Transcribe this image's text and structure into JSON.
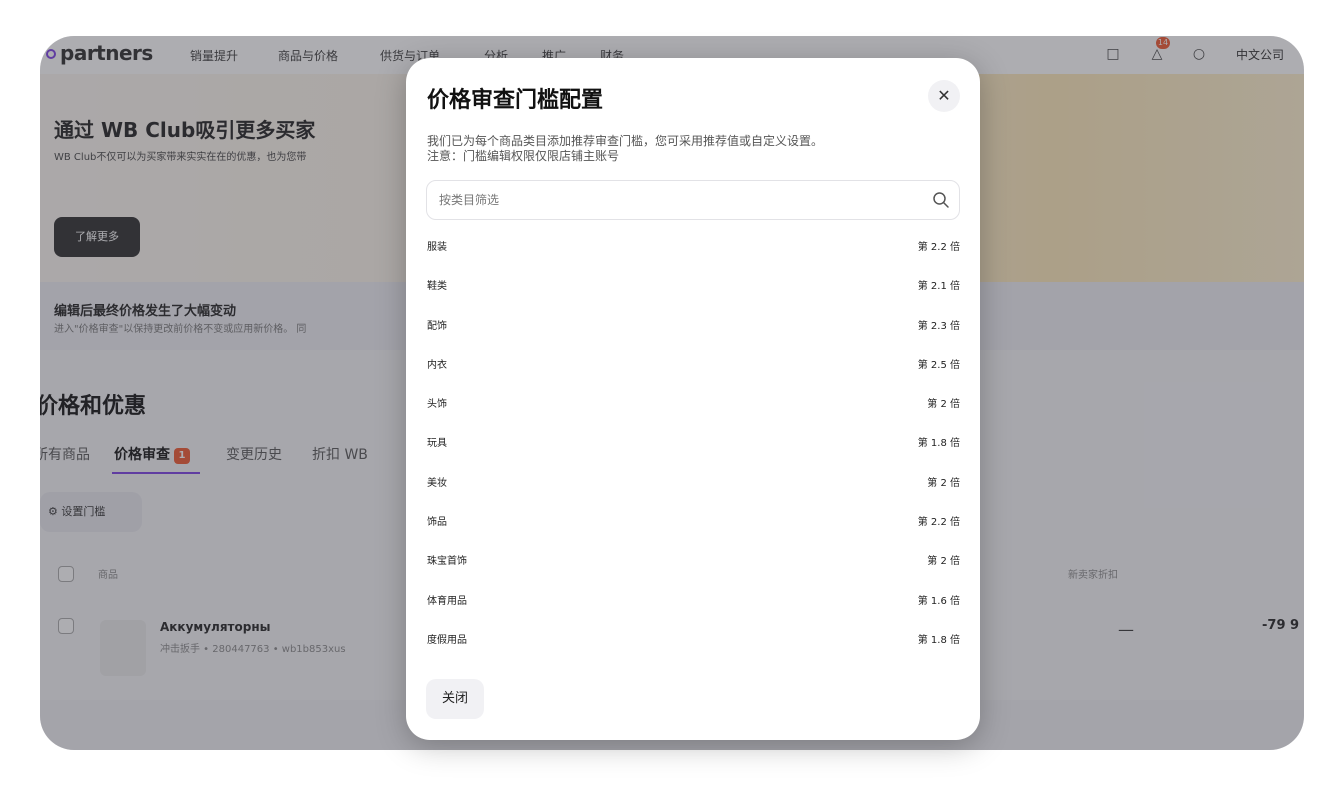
{
  "nav": {
    "logo": "partners",
    "items": [
      "销量提升",
      "商品与价格",
      "供货与订单",
      "分析",
      "推广",
      "财务"
    ],
    "notification_count": "14",
    "company": "中文公司"
  },
  "banner": {
    "title": "通过 WB Club吸引更多买家",
    "subtitle": "WB Club不仅可以为买家带来实实在在的优惠，也为您带",
    "button": "了解更多"
  },
  "alert": {
    "title": "编辑后最终价格发生了大幅变动",
    "subtitle": "进入\"价格审查\"以保持更改前价格不变或应用新价格。 同"
  },
  "page": {
    "title": "价格和优惠",
    "tabs": [
      {
        "label": "所有商品"
      },
      {
        "label": "价格审查",
        "badge": "1"
      },
      {
        "label": "变更历史"
      },
      {
        "label": "折扣 WB"
      }
    ],
    "threshold_button": "设置门槛",
    "table": {
      "col_product": "商品",
      "col_new_seller_discount": "新卖家折扣",
      "row": {
        "name": "Аккумуляторны",
        "meta": "冲击扳手 • 280447763 • wb1b853xus",
        "discount": "—",
        "price": "-79 9"
      }
    }
  },
  "modal": {
    "title": "价格审查门槛配置",
    "description_line1": "我们已为每个商品类目添加推荐审查门槛，您可采用推荐值或自定义设置。",
    "description_line2": "注意：门槛编辑权限仅限店铺主账号",
    "search_placeholder": "按类目筛选",
    "categories": [
      {
        "name": "服装",
        "multiplier": "第 2.2 倍"
      },
      {
        "name": "鞋类",
        "multiplier": "第 2.1 倍"
      },
      {
        "name": "配饰",
        "multiplier": "第 2.3 倍"
      },
      {
        "name": "内衣",
        "multiplier": "第 2.5 倍"
      },
      {
        "name": "头饰",
        "multiplier": "第 2 倍"
      },
      {
        "name": "玩具",
        "multiplier": "第 1.8 倍"
      },
      {
        "name": "美妆",
        "multiplier": "第 2 倍"
      },
      {
        "name": "饰品",
        "multiplier": "第 2.2 倍"
      },
      {
        "name": "珠宝首饰",
        "multiplier": "第 2 倍"
      },
      {
        "name": "体育用品",
        "multiplier": "第 1.6 倍"
      },
      {
        "name": "度假用品",
        "multiplier": "第 1.8 倍"
      }
    ],
    "close_button": "关闭"
  },
  "colors": {
    "accent": "#7b3fe4",
    "badge": "#f0562d"
  }
}
